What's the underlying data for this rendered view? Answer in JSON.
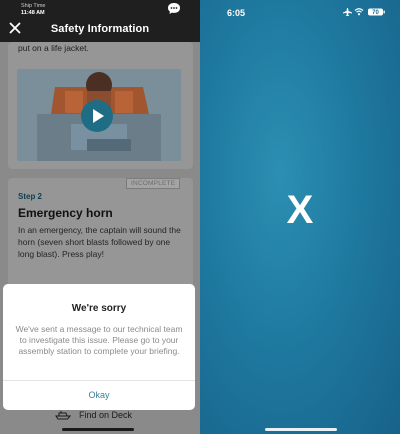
{
  "header": {
    "ship_time_label": "Ship Time",
    "ship_time_value": "11:48 AM",
    "title": "Safety Information"
  },
  "card1": {
    "text": "put on a life jacket."
  },
  "card2": {
    "badge": "INCOMPLETE",
    "step_label": "Step 2",
    "title": "Emergency horn",
    "body": "In an emergency, the captain will sound the horn (seven short blasts followed by one long blast). Press play!"
  },
  "dialog": {
    "title": "We're sorry",
    "message": "We've sent a message to our technical team to investigate this issue. Please go to your assembly station to complete your briefing.",
    "button": "Okay"
  },
  "bottom": {
    "find_on_deck": "Find on Deck"
  },
  "right": {
    "time": "6:05",
    "battery": "70",
    "mark": "X"
  },
  "colors": {
    "accent": "#3a7d9c",
    "ocean": "#1f7aa0",
    "header_bg": "#1f1f1f"
  }
}
